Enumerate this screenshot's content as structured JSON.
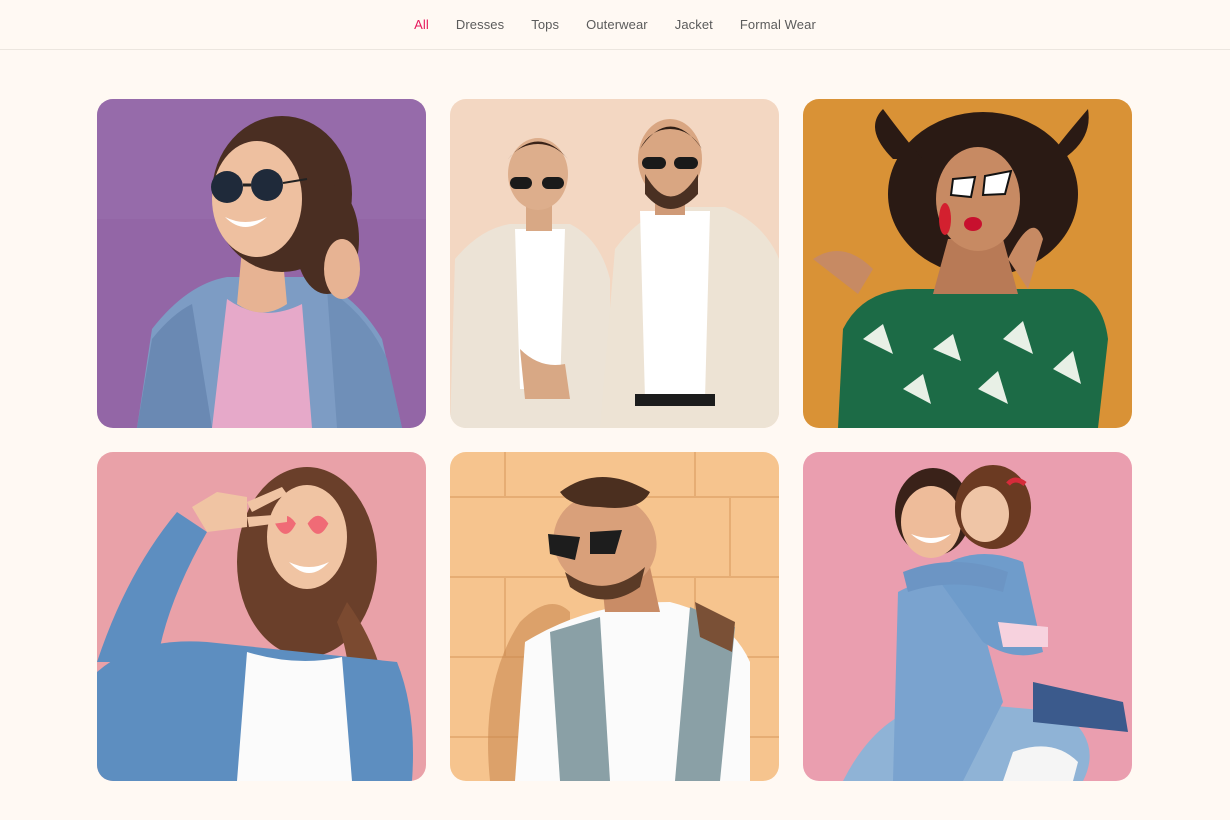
{
  "filters": [
    {
      "label": "All",
      "active": true
    },
    {
      "label": "Dresses",
      "active": false
    },
    {
      "label": "Tops",
      "active": false
    },
    {
      "label": "Outerwear",
      "active": false
    },
    {
      "label": "Jacket",
      "active": false
    },
    {
      "label": "Formal Wear",
      "active": false
    }
  ],
  "colors": {
    "page_bg": "#fff9f3",
    "active_tab": "#e6195c",
    "tab_text": "#5b5b5b"
  },
  "gallery": [
    {
      "subject": "woman in round sunglasses and denim jacket",
      "bg": "#9366a6"
    },
    {
      "subject": "two men in cream suits and sunglasses",
      "bg": "#f3d7c2"
    },
    {
      "subject": "woman in cat-eye sunglasses and green floral top",
      "bg": "#d99236"
    },
    {
      "subject": "woman in pink heart sunglasses making peace sign",
      "bg": "#e9a1a8"
    },
    {
      "subject": "man in sunglasses leaning on yellow brick wall",
      "bg": "#f6c48e"
    },
    {
      "subject": "mother and daughter hugging in denim",
      "bg": "#ea9eaf"
    }
  ]
}
